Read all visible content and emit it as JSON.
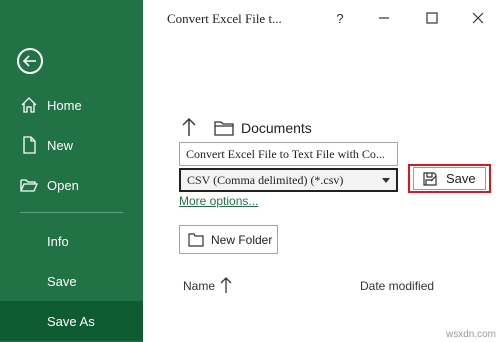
{
  "sidebar": {
    "items": [
      {
        "label": "Home",
        "icon": "home-icon"
      },
      {
        "label": "New",
        "icon": "new-document-icon"
      },
      {
        "label": "Open",
        "icon": "open-folder-icon"
      },
      {
        "label": "Info"
      },
      {
        "label": "Save"
      },
      {
        "label": "Save As",
        "selected": true
      }
    ]
  },
  "titlebar": {
    "title": "Convert Excel File t...",
    "help": "?"
  },
  "location": {
    "folder": "Documents"
  },
  "filename": {
    "value": "Convert Excel File to Text File with Co..."
  },
  "filetype": {
    "value": "CSV (Comma delimited) (*.csv)"
  },
  "more_options": "More options...",
  "save_button": "Save",
  "new_folder_button": "New Folder",
  "columns": {
    "name": "Name",
    "date_modified": "Date modified"
  },
  "watermark": "wsxdn.com",
  "colors": {
    "sidebar": "#217346",
    "sidebar_selected": "#0f5c33",
    "highlight": "#e0141e"
  }
}
